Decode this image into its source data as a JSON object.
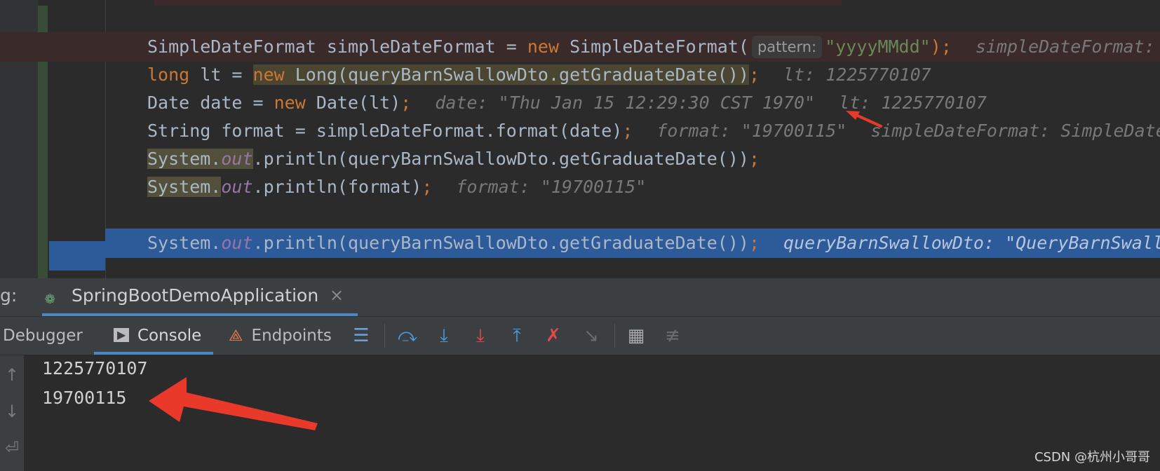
{
  "code": {
    "l1": {
      "type": "SimpleDateFormat",
      "var": " simpleDateFormat = ",
      "kw": "new",
      "ctor": " SimpleDateFormat(",
      "param_hint": "pattern:",
      "str": "\"yyyyMMdd\"",
      "end": ");",
      "hint": "simpleDateFormat: SimpleDateFormat"
    },
    "l2": {
      "kw1": "long",
      "mid": " lt = ",
      "kw": "new",
      "call": " Long(queryBarnSwallowDto.getGraduateDate())",
      "end": ";",
      "hint": "lt: 1225770107"
    },
    "l3": {
      "pre": "Date date = ",
      "kw": "new",
      "call": " Date(lt)",
      "end": ";",
      "hint": "date: \"Thu Jan 15 12:29:30 CST 1970\"",
      "hint2": "lt: 1225770107"
    },
    "l4": {
      "pre": "String format = simpleDateFormat.format(date)",
      "end": ";",
      "hint": "format: \"19700115\"",
      "hint2": "simpleDateFormat: SimpleDateFormat"
    },
    "l5": {
      "cls": "System.",
      "fld": "out",
      "call": ".println(queryBarnSwallowDto.getGraduateDate())",
      "end": ";"
    },
    "l6": {
      "cls": "System.",
      "fld": "out",
      "call": ".println(format)",
      "end": ";",
      "hint": "format: \"19700115\""
    },
    "l7": {
      "cls": "System.",
      "fld": "out",
      "call": ".println(queryBarnSwallowDto.getGraduateDate())",
      "end": ";",
      "hint": "queryBarnSwallowDto: \"QueryBarnSwallowDto\""
    }
  },
  "tool_window": {
    "prefix": "g:",
    "run_config": "SpringBootDemoApplication",
    "close_glyph": "×"
  },
  "debug_tabs": [
    {
      "label": "Debugger",
      "active": false
    },
    {
      "label": "Console",
      "active": true
    },
    {
      "label": "Endpoints",
      "active": false
    }
  ],
  "toolbar_icons": [
    "menu-icon",
    "step-over-icon",
    "step-into-icon",
    "force-step-into-icon",
    "step-out-icon",
    "drop-frame-icon",
    "run-to-cursor-icon",
    "evaluate-icon",
    "trace-icon"
  ],
  "console": {
    "lines": [
      "1225770107",
      "19700115"
    ]
  },
  "watermark": "CSDN @杭州小哥哥",
  "colors": {
    "annotation_arrow": "#e8392b",
    "accent": "#4a88c7",
    "keyword": "#cc7832",
    "string": "#6a8759"
  }
}
